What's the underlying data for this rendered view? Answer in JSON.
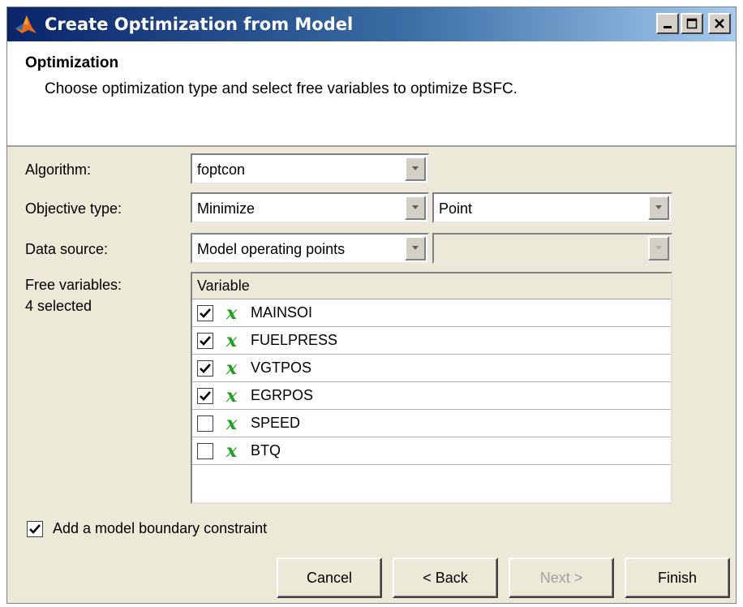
{
  "window": {
    "title": "Create Optimization from Model"
  },
  "header": {
    "title": "Optimization",
    "description": "Choose optimization type and select free variables to optimize BSFC."
  },
  "form": {
    "algorithm_label": "Algorithm:",
    "algorithm_value": "foptcon",
    "objective_label": "Objective type:",
    "objective_value": "Minimize",
    "objective_sub_value": "Point",
    "data_source_label": "Data source:",
    "data_source_value": "Model operating points",
    "data_source_sub_value": "",
    "free_vars_label": "Free variables:",
    "free_vars_count": "4 selected"
  },
  "table": {
    "column_header": "Variable",
    "rows": [
      {
        "name": "MAINSOI",
        "checked": true,
        "symbol": "x"
      },
      {
        "name": "FUELPRESS",
        "checked": true,
        "symbol": "x"
      },
      {
        "name": "VGTPOS",
        "checked": true,
        "symbol": "x"
      },
      {
        "name": "EGRPOS",
        "checked": true,
        "symbol": "x"
      },
      {
        "name": "SPEED",
        "checked": false,
        "symbol": "x"
      },
      {
        "name": "BTQ",
        "checked": false,
        "symbol": "x"
      }
    ]
  },
  "boundary": {
    "label": "Add a model boundary constraint",
    "checked": true
  },
  "buttons": {
    "cancel": "Cancel",
    "back": "< Back",
    "next": "Next >",
    "finish": "Finish"
  },
  "colors": {
    "title_gradient_start": "#0a246a",
    "title_gradient_end": "#a6caf0",
    "dialog_bg": "#ece9d8",
    "variable_symbol": "#1ea01e"
  },
  "icons": {
    "title": "matlab-icon",
    "minimize": "minimize-icon",
    "maximize": "maximize-icon",
    "close": "close-icon",
    "dropdown": "chevron-down-icon",
    "check": "check-icon"
  }
}
